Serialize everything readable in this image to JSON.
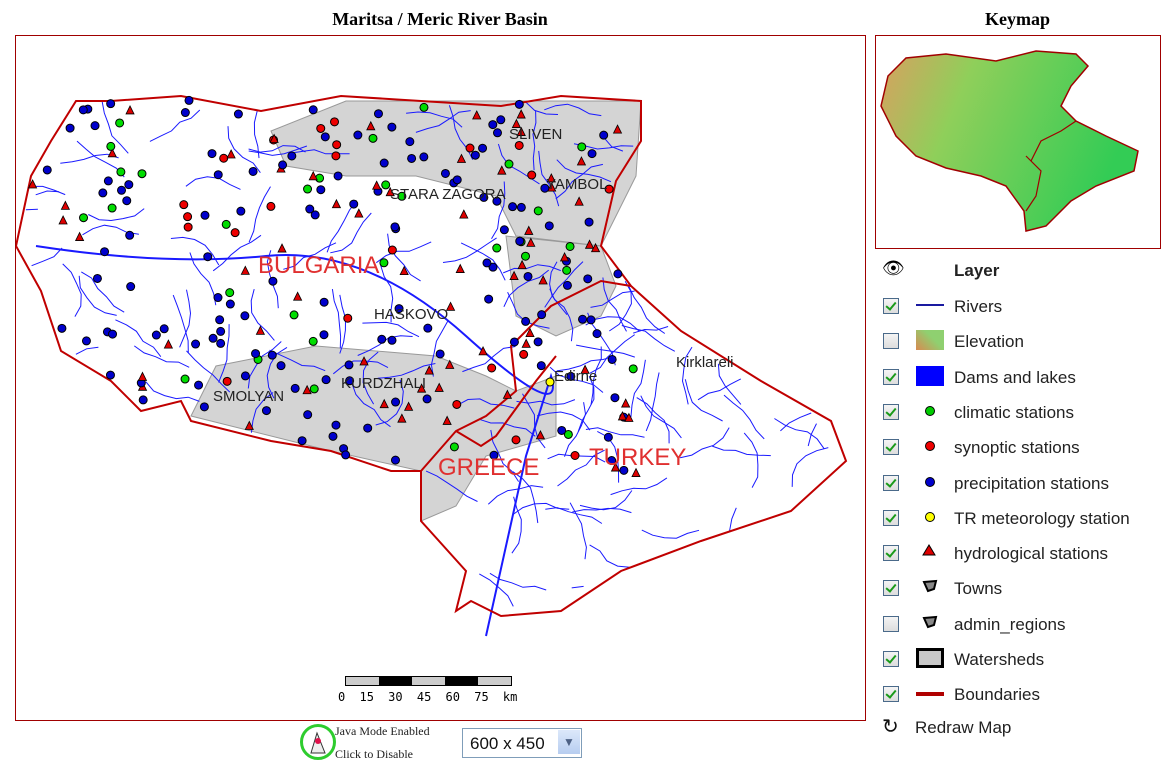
{
  "map": {
    "title": "Maritsa / Meric River Basin",
    "towns": [
      "SLIVEN",
      "YAMBOL",
      "STARA ZAGORA",
      "HASKOVO",
      "SMOLYAN",
      "KURDZHALI",
      "Edirne",
      "Kirklareli"
    ],
    "countries": [
      "BULGARIA",
      "GREECE",
      "TURKEY"
    ],
    "scale": {
      "ticks": [
        "0",
        "15",
        "30",
        "45",
        "60",
        "75"
      ],
      "unit": "km"
    }
  },
  "keymap": {
    "title": "Keymap"
  },
  "legend": {
    "header": "Layer",
    "layers": [
      {
        "label": "Rivers",
        "checked": true,
        "symbol": "line",
        "color": "#1a1aa0"
      },
      {
        "label": "Elevation",
        "checked": false,
        "symbol": "elevation-swatch"
      },
      {
        "label": "Dams and lakes",
        "checked": true,
        "symbol": "fill",
        "color": "#0000ff"
      },
      {
        "label": "climatic stations",
        "checked": true,
        "symbol": "dot",
        "color": "#00cc00"
      },
      {
        "label": "synoptic stations",
        "checked": true,
        "symbol": "dot",
        "color": "#ee0000"
      },
      {
        "label": "precipitation stations",
        "checked": true,
        "symbol": "dot",
        "color": "#0000cc"
      },
      {
        "label": "TR meteorology station",
        "checked": true,
        "symbol": "dot",
        "color": "#ffff00"
      },
      {
        "label": "hydrological stations",
        "checked": true,
        "symbol": "triangle",
        "color": "#dd0000"
      },
      {
        "label": "Towns",
        "checked": true,
        "symbol": "town-icon"
      },
      {
        "label": "admin_regions",
        "checked": false,
        "symbol": "town-icon"
      },
      {
        "label": "Watersheds",
        "checked": true,
        "symbol": "box",
        "color": "#c8c8c8"
      },
      {
        "label": "Boundaries",
        "checked": true,
        "symbol": "line",
        "color": "#b00000"
      }
    ],
    "redraw": "Redraw Map"
  },
  "footer": {
    "java_line1": "Java Mode Enabled",
    "java_line2": "Click to Disable",
    "map_size": "600 x 450"
  }
}
